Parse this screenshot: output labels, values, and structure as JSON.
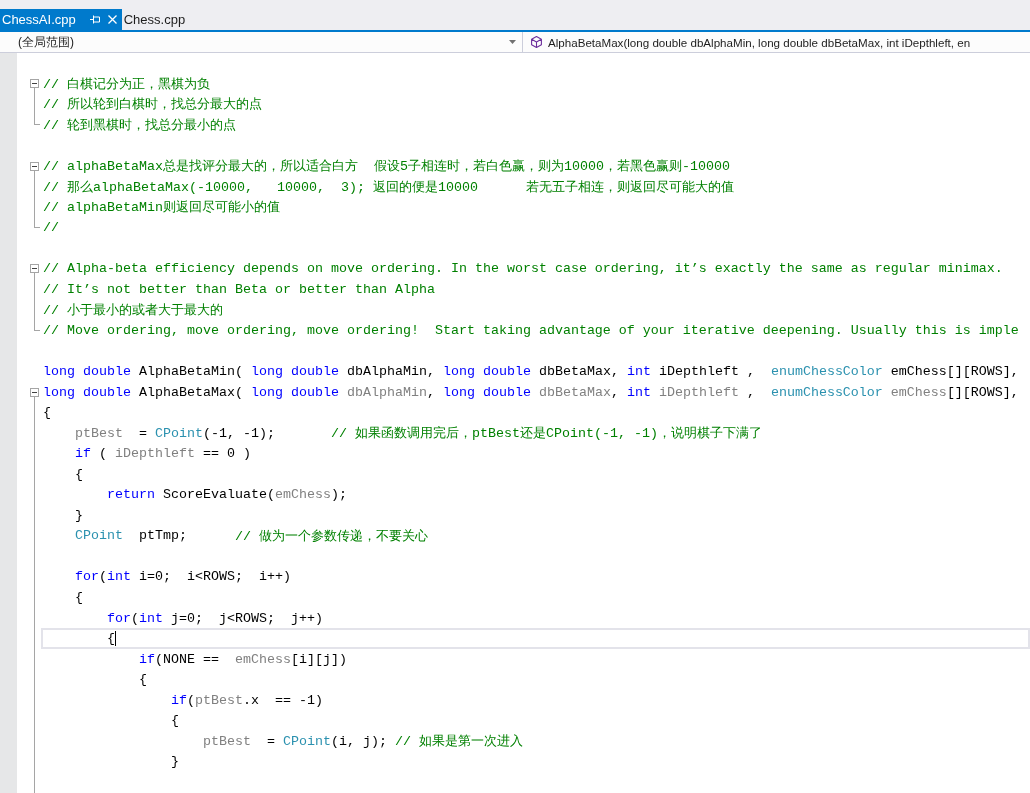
{
  "tabs": [
    {
      "label": "ChessAI.cpp",
      "selected": true
    },
    {
      "label": "Chess.cpp",
      "selected": false
    }
  ],
  "navigation": {
    "scope": "(全局范围)",
    "member": "AlphaBetaMax(long double dbAlphaMin, long double dbBetaMax, int iDepthleft, en"
  },
  "editor": {
    "lines": [
      {
        "kind": "line",
        "current": false
      },
      {
        "kind": "region",
        "expanded": true,
        "continues": false,
        "children": [
          {
            "current": false,
            "tokens": [
              {
                "text": "// 白棋记分为正，黑棋为负",
                "kind": "comment"
              }
            ]
          },
          {
            "current": false,
            "tokens": [
              {
                "text": "// 所以轮到白棋时，找总分最大的点",
                "kind": "comment"
              }
            ]
          },
          {
            "current": false,
            "tokens": [
              {
                "text": "// 轮到黑棋时，找总分最小的点",
                "kind": "comment"
              }
            ]
          }
        ]
      },
      {
        "kind": "line",
        "current": false
      },
      {
        "kind": "region",
        "expanded": true,
        "continues": false,
        "children": [
          {
            "current": false,
            "tokens": [
              {
                "text": "// alphaBetaMax总是找评分最大的，所以适合白方  假设5子相连时，若白色赢，则为10000，若黑色赢则-10000",
                "kind": "comment"
              }
            ]
          },
          {
            "current": false,
            "tokens": [
              {
                "text": "// 那么alphaBetaMax(-10000,   10000,  3); 返回的便是10000      若无五子相连，则返回尽可能大的值",
                "kind": "comment"
              }
            ]
          },
          {
            "current": false,
            "tokens": [
              {
                "text": "// alphaBetaMin则返回尽可能小的值",
                "kind": "comment"
              }
            ]
          },
          {
            "current": false,
            "tokens": [
              {
                "text": "//",
                "kind": "comment"
              }
            ]
          }
        ]
      },
      {
        "kind": "line",
        "current": false
      },
      {
        "kind": "region",
        "expanded": true,
        "continues": false,
        "children": [
          {
            "current": false,
            "tokens": [
              {
                "text": "// Alpha-beta efficiency depends on move ordering. In the worst case ordering, it’s exactly the same as regular minimax.",
                "kind": "comment"
              }
            ]
          },
          {
            "current": false,
            "tokens": [
              {
                "text": "// It’s not better than Beta or better than Alpha",
                "kind": "comment"
              }
            ]
          },
          {
            "current": false,
            "tokens": [
              {
                "text": "// 小于最小的或者大于最大的",
                "kind": "comment"
              }
            ]
          },
          {
            "current": false,
            "tokens": [
              {
                "text": "// Move ordering, move ordering, move ordering!  Start taking advantage of your iterative deepening. Usually this is imple",
                "kind": "comment"
              }
            ]
          }
        ]
      },
      {
        "kind": "line",
        "current": false
      },
      {
        "kind": "line",
        "current": false,
        "tokens": [
          {
            "text": "long double",
            "kind": "keyword"
          },
          {
            "text": " AlphaBetaMin( ",
            "kind": "text"
          },
          {
            "text": "long double",
            "kind": "keyword"
          },
          {
            "text": " dbAlphaMin, ",
            "kind": "text"
          },
          {
            "text": "long double",
            "kind": "keyword"
          },
          {
            "text": " dbBetaMax, ",
            "kind": "text"
          },
          {
            "text": "int",
            "kind": "keyword"
          },
          {
            "text": " iDepthleft ,  ",
            "kind": "text"
          },
          {
            "text": "enumChessColor",
            "kind": "type"
          },
          {
            "text": " emChess[][ROWS],",
            "kind": "text"
          }
        ]
      },
      {
        "kind": "region",
        "expanded": true,
        "continues": true,
        "children": [
          {
            "current": false,
            "tokens": [
              {
                "text": "long double",
                "kind": "keyword"
              },
              {
                "text": " AlphaBetaMax( ",
                "kind": "text"
              },
              {
                "text": "long double",
                "kind": "keyword"
              },
              {
                "text": " dbAlphaMin",
                "kind": "param"
              },
              {
                "text": ", ",
                "kind": "text"
              },
              {
                "text": "long double",
                "kind": "keyword"
              },
              {
                "text": " dbBetaMax",
                "kind": "param"
              },
              {
                "text": ", ",
                "kind": "text"
              },
              {
                "text": "int",
                "kind": "keyword"
              },
              {
                "text": " iDepthleft",
                "kind": "param"
              },
              {
                "text": " ,  ",
                "kind": "text"
              },
              {
                "text": "enumChessColor",
                "kind": "type"
              },
              {
                "text": " emChess",
                "kind": "param"
              },
              {
                "text": "[][ROWS],",
                "kind": "text"
              }
            ]
          },
          {
            "current": false,
            "tokens": [
              {
                "text": "{",
                "kind": "text"
              }
            ]
          },
          {
            "current": false,
            "tokens": [
              {
                "text": "    ptBest",
                "kind": "param"
              },
              {
                "text": "  = ",
                "kind": "text"
              },
              {
                "text": "CPoint",
                "kind": "type"
              },
              {
                "text": "(-1, -1);       ",
                "kind": "text"
              },
              {
                "text": "// 如果函数调用完后，ptBest还是CPoint(-1, -1)，说明棋子下满了",
                "kind": "comment"
              }
            ]
          },
          {
            "current": false,
            "tokens": [
              {
                "text": "    if",
                "kind": "keyword"
              },
              {
                "text": " ( ",
                "kind": "text"
              },
              {
                "text": "iDepthleft",
                "kind": "param"
              },
              {
                "text": " == 0 )",
                "kind": "text"
              }
            ]
          },
          {
            "current": false,
            "tokens": [
              {
                "text": "    {",
                "kind": "text"
              }
            ]
          },
          {
            "current": false,
            "tokens": [
              {
                "text": "        return",
                "kind": "keyword"
              },
              {
                "text": " ScoreEvaluate(",
                "kind": "text"
              },
              {
                "text": "emChess",
                "kind": "param"
              },
              {
                "text": ");",
                "kind": "text"
              }
            ]
          },
          {
            "current": false,
            "tokens": [
              {
                "text": "    }",
                "kind": "text"
              }
            ]
          },
          {
            "current": false,
            "tokens": [
              {
                "text": "    CPoint",
                "kind": "type"
              },
              {
                "text": "  ptTmp;      ",
                "kind": "text"
              },
              {
                "text": "// 做为一个参数传递，不要关心",
                "kind": "comment"
              }
            ]
          },
          {
            "current": false
          },
          {
            "current": false,
            "tokens": [
              {
                "text": "    for",
                "kind": "keyword"
              },
              {
                "text": "(",
                "kind": "text"
              },
              {
                "text": "int",
                "kind": "keyword"
              },
              {
                "text": " i=0;  i<ROWS;  i++)",
                "kind": "text"
              }
            ]
          },
          {
            "current": false,
            "tokens": [
              {
                "text": "    {",
                "kind": "text"
              }
            ]
          },
          {
            "current": false,
            "tokens": [
              {
                "text": "        for",
                "kind": "keyword"
              },
              {
                "text": "(",
                "kind": "text"
              },
              {
                "text": "int",
                "kind": "keyword"
              },
              {
                "text": " j=0;  j<ROWS;  j++)",
                "kind": "text"
              }
            ]
          },
          {
            "current": true,
            "tokens": [
              {
                "text": "        {",
                "kind": "text"
              }
            ]
          },
          {
            "current": false,
            "tokens": [
              {
                "text": "            if",
                "kind": "keyword"
              },
              {
                "text": "(NONE ==  ",
                "kind": "text"
              },
              {
                "text": "emChess",
                "kind": "param"
              },
              {
                "text": "[i][j])",
                "kind": "text"
              }
            ]
          },
          {
            "current": false,
            "tokens": [
              {
                "text": "            {",
                "kind": "text"
              }
            ]
          },
          {
            "current": false,
            "tokens": [
              {
                "text": "                if",
                "kind": "keyword"
              },
              {
                "text": "(",
                "kind": "text"
              },
              {
                "text": "ptBest",
                "kind": "param"
              },
              {
                "text": ".x  == -1)",
                "kind": "text"
              }
            ]
          },
          {
            "current": false,
            "tokens": [
              {
                "text": "                {",
                "kind": "text"
              }
            ]
          },
          {
            "current": false,
            "tokens": [
              {
                "text": "                    ptBest",
                "kind": "param"
              },
              {
                "text": "  = ",
                "kind": "text"
              },
              {
                "text": "CPoint",
                "kind": "type"
              },
              {
                "text": "(i, j); ",
                "kind": "text"
              },
              {
                "text": "// 如果是第一次进入",
                "kind": "comment"
              }
            ]
          },
          {
            "current": false,
            "tokens": [
              {
                "text": "                }",
                "kind": "text"
              }
            ]
          },
          {
            "current": false
          }
        ]
      }
    ]
  }
}
